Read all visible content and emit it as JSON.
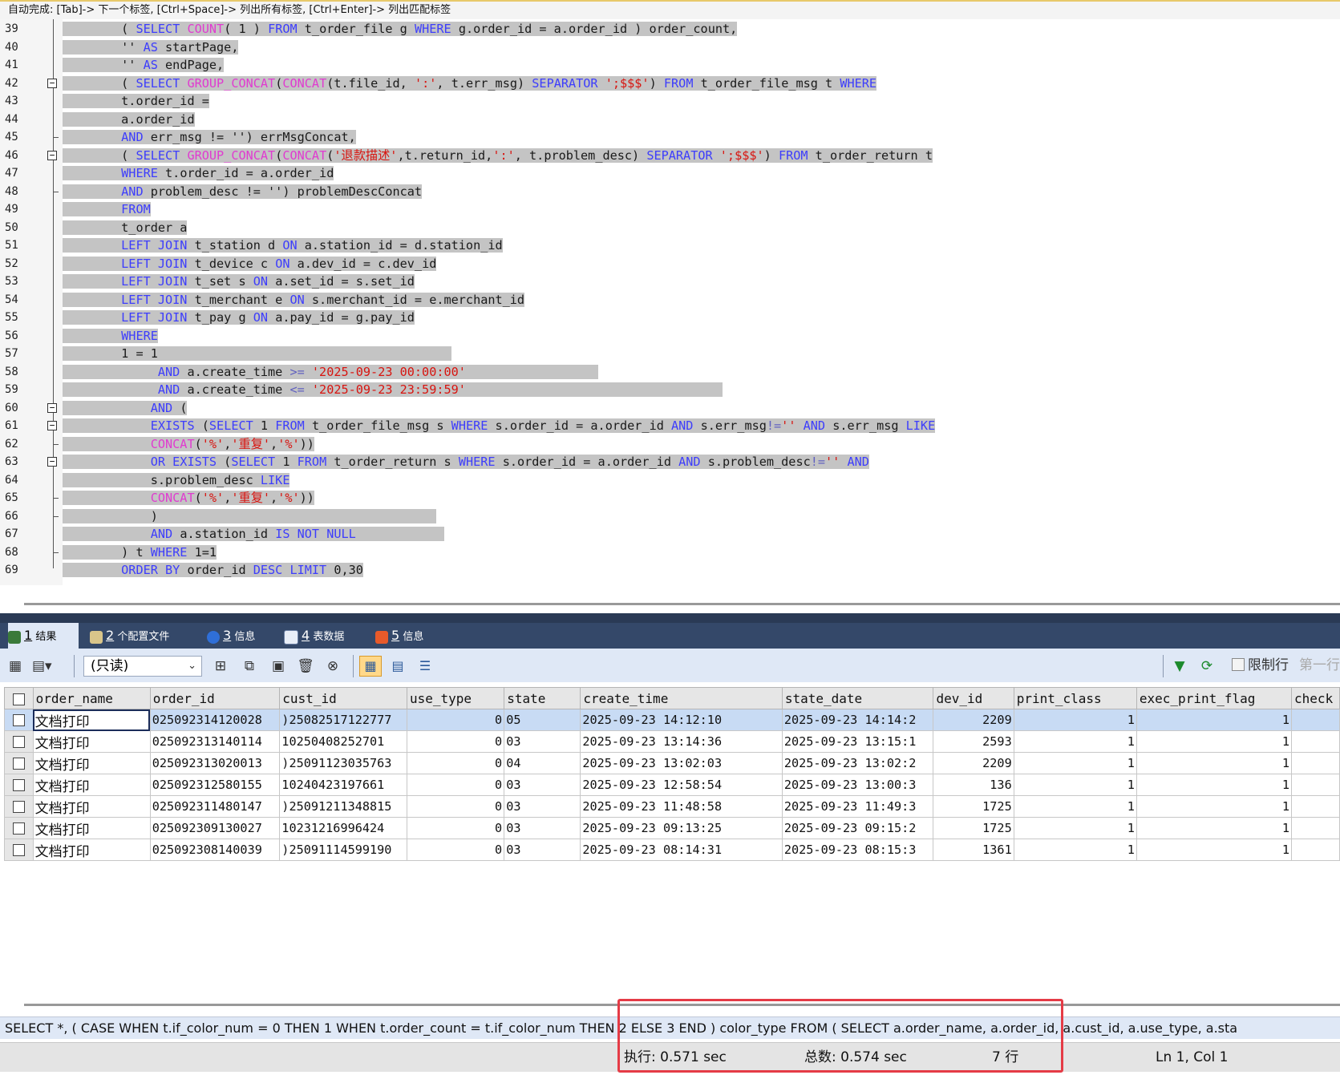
{
  "autocomplete_hint": "自动完成: [Tab]-> 下一个标签, [Ctrl+Space]-> 列出所有标签, [Ctrl+Enter]-> 列出匹配标签",
  "editor": {
    "lines": [
      {
        "n": "39",
        "indent": "        ",
        "tokens": [
          [
            "pl",
            "( "
          ],
          [
            "kw",
            "SELECT "
          ],
          [
            "fn",
            "COUNT"
          ],
          [
            "pl",
            "( 1 ) "
          ],
          [
            "kw",
            "FROM "
          ],
          [
            "pl",
            "t_order_file g "
          ],
          [
            "kw",
            "WHERE "
          ],
          [
            "pl",
            "g.order_id = a.order_id ) order_count,"
          ]
        ]
      },
      {
        "n": "40",
        "indent": "        ",
        "tokens": [
          [
            "pl",
            "'' "
          ],
          [
            "kw",
            "AS "
          ],
          [
            "pl",
            "startPage,"
          ]
        ]
      },
      {
        "n": "41",
        "indent": "        ",
        "tokens": [
          [
            "pl",
            "'' "
          ],
          [
            "kw",
            "AS "
          ],
          [
            "pl",
            "endPage,"
          ]
        ]
      },
      {
        "n": "42",
        "indent": "        ",
        "tokens": [
          [
            "pl",
            "( "
          ],
          [
            "kw",
            "SELECT "
          ],
          [
            "fn",
            "GROUP_CONCAT"
          ],
          [
            "pl",
            "("
          ],
          [
            "fn",
            "CONCAT"
          ],
          [
            "pl",
            "(t.file_id, "
          ],
          [
            "str",
            "':'"
          ],
          [
            "pl",
            ", t.err_msg) "
          ],
          [
            "kw",
            "SEPARATOR "
          ],
          [
            "str",
            "';$$$'"
          ],
          [
            "pl",
            ") "
          ],
          [
            "kw",
            "FROM "
          ],
          [
            "pl",
            "t_order_file_msg t "
          ],
          [
            "kw",
            "WHERE"
          ]
        ]
      },
      {
        "n": "43",
        "indent": "        ",
        "tokens": [
          [
            "pl",
            "t.order_id ="
          ]
        ]
      },
      {
        "n": "44",
        "indent": "        ",
        "tokens": [
          [
            "pl",
            "a.order_id"
          ]
        ]
      },
      {
        "n": "45",
        "indent": "        ",
        "tokens": [
          [
            "kw",
            "AND "
          ],
          [
            "pl",
            "err_msg != '') errMsgConcat,"
          ]
        ]
      },
      {
        "n": "46",
        "indent": "        ",
        "tokens": [
          [
            "pl",
            "( "
          ],
          [
            "kw",
            "SELECT "
          ],
          [
            "fn",
            "GROUP_CONCAT"
          ],
          [
            "pl",
            "("
          ],
          [
            "fn",
            "CONCAT"
          ],
          [
            "pl",
            "("
          ],
          [
            "str",
            "'退款描述'"
          ],
          [
            "pl",
            ",t.return_id,"
          ],
          [
            "str",
            "':'"
          ],
          [
            "pl",
            ", t.problem_desc) "
          ],
          [
            "kw",
            "SEPARATOR "
          ],
          [
            "str",
            "';$$$'"
          ],
          [
            "pl",
            ") "
          ],
          [
            "kw",
            "FROM "
          ],
          [
            "pl",
            "t_order_return t"
          ]
        ]
      },
      {
        "n": "47",
        "indent": "        ",
        "tokens": [
          [
            "kw",
            "WHERE "
          ],
          [
            "pl",
            "t.order_id = a.order_id"
          ]
        ]
      },
      {
        "n": "48",
        "indent": "        ",
        "tokens": [
          [
            "kw",
            "AND "
          ],
          [
            "pl",
            "problem_desc != '') problemDescConcat"
          ]
        ]
      },
      {
        "n": "49",
        "indent": "        ",
        "tokens": [
          [
            "kw",
            "FROM"
          ]
        ]
      },
      {
        "n": "50",
        "indent": "        ",
        "tokens": [
          [
            "pl",
            "t_order a"
          ]
        ]
      },
      {
        "n": "51",
        "indent": "        ",
        "tokens": [
          [
            "kw",
            "LEFT JOIN "
          ],
          [
            "pl",
            "t_station d "
          ],
          [
            "kw",
            "ON "
          ],
          [
            "pl",
            "a.station_id = d.station_id"
          ]
        ]
      },
      {
        "n": "52",
        "indent": "        ",
        "tokens": [
          [
            "kw",
            "LEFT JOIN "
          ],
          [
            "pl",
            "t_device c "
          ],
          [
            "kw",
            "ON "
          ],
          [
            "pl",
            "a.dev_id = c.dev_id"
          ]
        ]
      },
      {
        "n": "53",
        "indent": "        ",
        "tokens": [
          [
            "kw",
            "LEFT JOIN "
          ],
          [
            "pl",
            "t_set s "
          ],
          [
            "kw",
            "ON "
          ],
          [
            "pl",
            "a.set_id = s.set_id"
          ]
        ]
      },
      {
        "n": "54",
        "indent": "        ",
        "tokens": [
          [
            "kw",
            "LEFT JOIN "
          ],
          [
            "pl",
            "t_merchant e "
          ],
          [
            "kw",
            "ON "
          ],
          [
            "pl",
            "s.merchant_id = e.merchant_id"
          ]
        ]
      },
      {
        "n": "55",
        "indent": "        ",
        "tokens": [
          [
            "kw",
            "LEFT JOIN "
          ],
          [
            "pl",
            "t_pay g "
          ],
          [
            "kw",
            "ON "
          ],
          [
            "pl",
            "a.pay_id = g.pay_id"
          ]
        ]
      },
      {
        "n": "56",
        "indent": "        ",
        "tokens": [
          [
            "kw",
            "WHERE"
          ]
        ]
      },
      {
        "n": "57",
        "indent": "        ",
        "tokens": [
          [
            "pl",
            "1 = 1                                        "
          ]
        ]
      },
      {
        "n": "58",
        "indent": "             ",
        "tokens": [
          [
            "kw",
            "AND "
          ],
          [
            "pl",
            "a.create_time "
          ],
          [
            "op",
            ">= "
          ],
          [
            "str",
            "'2025-09-23 00:00:00'"
          ],
          [
            "pl",
            "                  "
          ]
        ]
      },
      {
        "n": "59",
        "indent": "             ",
        "tokens": [
          [
            "kw",
            "AND "
          ],
          [
            "pl",
            "a.create_time "
          ],
          [
            "op",
            "<= "
          ],
          [
            "str",
            "'2025-09-23 23:59:59'"
          ],
          [
            "pl",
            "                                   "
          ]
        ]
      },
      {
        "n": "60",
        "indent": "            ",
        "tokens": [
          [
            "kw",
            "AND "
          ],
          [
            "pl",
            "("
          ]
        ]
      },
      {
        "n": "61",
        "indent": "            ",
        "tokens": [
          [
            "kw",
            "EXISTS "
          ],
          [
            "pl",
            "("
          ],
          [
            "kw",
            "SELECT "
          ],
          [
            "pl",
            "1 "
          ],
          [
            "kw",
            "FROM "
          ],
          [
            "pl",
            "t_order_file_msg s "
          ],
          [
            "kw",
            "WHERE "
          ],
          [
            "pl",
            "s.order_id = a.order_id "
          ],
          [
            "kw",
            "AND "
          ],
          [
            "pl",
            "s.err_msg"
          ],
          [
            "op",
            "!="
          ],
          [
            "str",
            "''"
          ],
          [
            "pl",
            " "
          ],
          [
            "kw",
            "AND "
          ],
          [
            "pl",
            "s.err_msg "
          ],
          [
            "kw",
            "LIKE"
          ]
        ]
      },
      {
        "n": "62",
        "indent": "            ",
        "tokens": [
          [
            "fn",
            "CONCAT"
          ],
          [
            "pl",
            "("
          ],
          [
            "str",
            "'%'"
          ],
          [
            "pl",
            ","
          ],
          [
            "str",
            "'重复'"
          ],
          [
            "pl",
            ","
          ],
          [
            "str",
            "'%'"
          ],
          [
            "pl",
            "))"
          ]
        ]
      },
      {
        "n": "63",
        "indent": "            ",
        "tokens": [
          [
            "kw",
            "OR EXISTS "
          ],
          [
            "pl",
            "("
          ],
          [
            "kw",
            "SELECT "
          ],
          [
            "pl",
            "1 "
          ],
          [
            "kw",
            "FROM "
          ],
          [
            "pl",
            "t_order_return s "
          ],
          [
            "kw",
            "WHERE "
          ],
          [
            "pl",
            "s.order_id = a.order_id "
          ],
          [
            "kw",
            "AND "
          ],
          [
            "pl",
            "s.problem_desc"
          ],
          [
            "op",
            "!="
          ],
          [
            "str",
            "''"
          ],
          [
            "pl",
            " "
          ],
          [
            "kw",
            "AND"
          ]
        ]
      },
      {
        "n": "64",
        "indent": "            ",
        "tokens": [
          [
            "pl",
            "s.problem_desc "
          ],
          [
            "kw",
            "LIKE"
          ]
        ]
      },
      {
        "n": "65",
        "indent": "            ",
        "tokens": [
          [
            "fn",
            "CONCAT"
          ],
          [
            "pl",
            "("
          ],
          [
            "str",
            "'%'"
          ],
          [
            "pl",
            ","
          ],
          [
            "str",
            "'重复'"
          ],
          [
            "pl",
            ","
          ],
          [
            "str",
            "'%'"
          ],
          [
            "pl",
            "))"
          ]
        ]
      },
      {
        "n": "66",
        "indent": "            ",
        "tokens": [
          [
            "pl",
            ")                                      "
          ]
        ]
      },
      {
        "n": "67",
        "indent": "            ",
        "tokens": [
          [
            "kw",
            "AND "
          ],
          [
            "pl",
            "a.station_id "
          ],
          [
            "kw",
            "IS NOT NULL"
          ],
          [
            "pl",
            "            "
          ]
        ]
      },
      {
        "n": "68",
        "indent": "        ",
        "tokens": [
          [
            "pl",
            ") t "
          ],
          [
            "kw",
            "WHERE "
          ],
          [
            "pl",
            "1=1"
          ]
        ]
      },
      {
        "n": "69",
        "indent": "        ",
        "tokens": [
          [
            "kw",
            "ORDER BY "
          ],
          [
            "pl",
            "order_id "
          ],
          [
            "kw",
            "DESC LIMIT "
          ],
          [
            "pl",
            "0,30"
          ]
        ]
      }
    ]
  },
  "tabs": [
    {
      "num": "1",
      "label": "结果",
      "icon_name": "result-icon"
    },
    {
      "num": "2",
      "label": "个配置文件",
      "icon_name": "profile-icon"
    },
    {
      "num": "3",
      "label": "信息",
      "icon_name": "info-icon"
    },
    {
      "num": "4",
      "label": "表数据",
      "icon_name": "table-data-icon"
    },
    {
      "num": "5",
      "label": "信息",
      "icon_name": "info-history-icon"
    }
  ],
  "toolbar": {
    "readonly_value": "(只读)",
    "limit_label": "限制行",
    "first_row_label": "第一行"
  },
  "grid": {
    "columns": [
      "order_name",
      "order_id",
      "cust_id",
      "use_type",
      "state",
      "create_time",
      "state_date",
      "dev_id",
      "print_class",
      "exec_print_flag",
      "check"
    ],
    "rows": [
      [
        "文档打印",
        "025092314120028",
        ")25082517122777",
        "0",
        "05",
        "2025-09-23 14:12:10",
        "2025-09-23 14:14:2",
        "2209",
        "1",
        "1",
        ""
      ],
      [
        "文档打印",
        "025092313140114",
        "10250408252701",
        "0",
        "03",
        "2025-09-23 13:14:36",
        "2025-09-23 13:15:1",
        "2593",
        "1",
        "1",
        ""
      ],
      [
        "文档打印",
        "025092313020013",
        ")25091123035763",
        "0",
        "04",
        "2025-09-23 13:02:03",
        "2025-09-23 13:02:2",
        "2209",
        "1",
        "1",
        ""
      ],
      [
        "文档打印",
        "025092312580155",
        "10240423197661",
        "0",
        "03",
        "2025-09-23 12:58:54",
        "2025-09-23 13:00:3",
        "136",
        "1",
        "1",
        ""
      ],
      [
        "文档打印",
        "025092311480147",
        ")25091211348815",
        "0",
        "03",
        "2025-09-23 11:48:58",
        "2025-09-23 11:49:3",
        "1725",
        "1",
        "1",
        ""
      ],
      [
        "文档打印",
        "025092309130027",
        "10231216996424",
        "0",
        "03",
        "2025-09-23 09:13:25",
        "2025-09-23 09:15:2",
        "1725",
        "1",
        "1",
        ""
      ],
      [
        "文档打印",
        "025092308140039",
        ")25091114599190",
        "0",
        "03",
        "2025-09-23 08:14:31",
        "2025-09-23 08:15:3",
        "1361",
        "1",
        "1",
        ""
      ]
    ]
  },
  "sql_text": "SELECT *, ( CASE WHEN t.if_color_num = 0 THEN 1 WHEN t.order_count = t.if_color_num THEN 2 ELSE 3 END ) color_type FROM ( SELECT a.order_name, a.order_id, a.cust_id, a.use_type, a.sta",
  "status": {
    "exec": "执行: 0.571 sec",
    "total": "总数: 0.574 sec",
    "rows": "7 行",
    "cursor": "Ln 1, Col 1"
  },
  "colors": {
    "highlight_box": "#e53b46",
    "keyword": "#3d3dfc",
    "function": "#e03bd0",
    "string": "#d8140f",
    "selection": "#c4c4c4"
  }
}
